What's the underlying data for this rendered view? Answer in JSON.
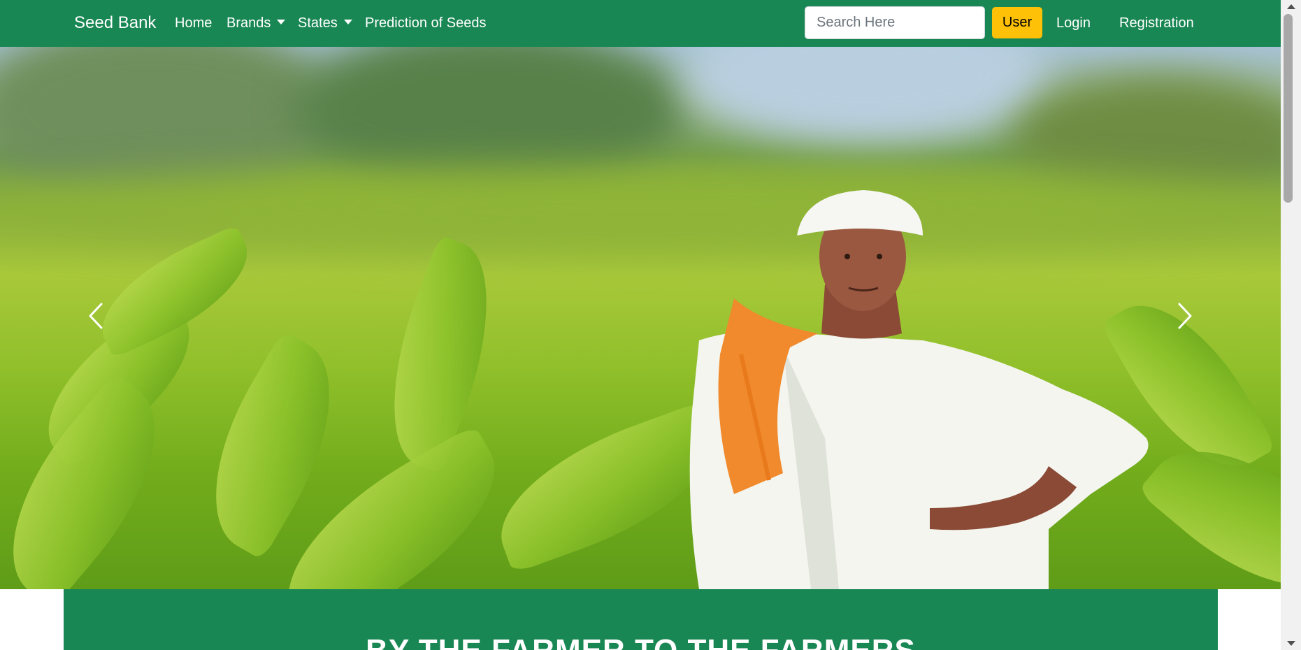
{
  "navbar": {
    "brand": "Seed Bank",
    "links": {
      "home": "Home",
      "brands": "Brands",
      "states": "States",
      "prediction": "Prediction of Seeds",
      "login": "Login",
      "registration": "Registration"
    },
    "search": {
      "placeholder": "Search Here",
      "value": ""
    },
    "user_button": "User"
  },
  "carousel": {
    "prev_icon": "chevron-left-icon",
    "next_icon": "chevron-right-icon"
  },
  "banner": {
    "title": "BY THE FARMER TO THE FARMERS"
  },
  "colors": {
    "primary_green": "#198754",
    "user_button": "#ffc107"
  }
}
